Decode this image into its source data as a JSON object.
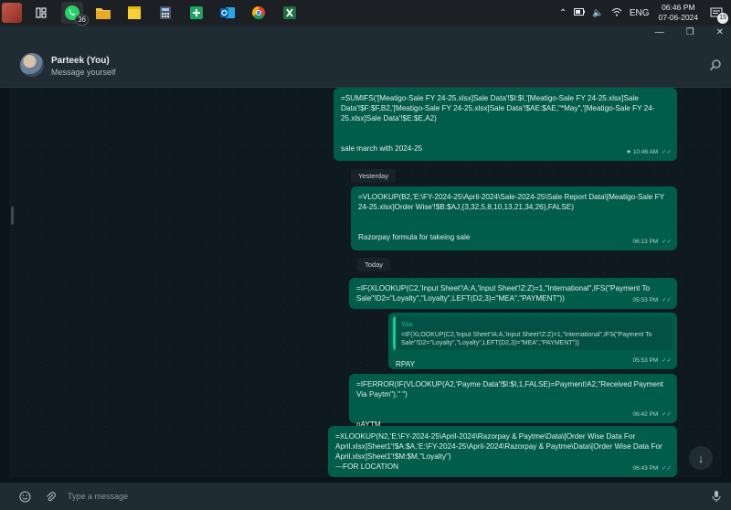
{
  "taskbar": {
    "apps": [
      {
        "name": "whatsapp",
        "badge": "36"
      },
      {
        "name": "file-explorer"
      },
      {
        "name": "sticky-notes"
      },
      {
        "name": "calculator"
      },
      {
        "name": "google-sheets"
      },
      {
        "name": "outlook"
      },
      {
        "name": "chrome"
      },
      {
        "name": "excel"
      }
    ],
    "language": "ENG",
    "time": "06:46 PM",
    "date": "07-06-2024",
    "notification_count": "15"
  },
  "header": {
    "name": "Parteek (You)",
    "subtitle": "Message yourself"
  },
  "messages": [
    {
      "text": "=SUMIFS('[Meatigo-Sale FY 24-25.xlsx]Sale Data'!$I:$I,'[Meatigo-Sale FY 24-25.xlsx]Sale Data'!$F:$F,B2,'[Meatigo-Sale FY 24-25.xlsx]Sale Data'!$AE:$AE,\"*May\",'[Meatigo-Sale FY 24-25.xlsx]Sale Data'!$E:$E,A2)\n\n\nsale march with 2024-25",
      "time": "10:46 AM",
      "starred": true
    },
    {
      "date_chip": "Yesterday"
    },
    {
      "text": "=VLOOKUP(B2,'E:\\FY-2024-25\\April-2024\\Sale-2024-25\\Sale Report Data\\[Meatigo-Sale FY 24-25.xlsx]Order Wise'!$B:$AJ,{3,32,5,8,10,13,21,34,26},FALSE)\n\n\nRazorpay formula for takeing sale",
      "time": "06:13 PM"
    },
    {
      "date_chip": "Today"
    },
    {
      "text": "=IF(XLOOKUP(C2,'Input Sheet'!A:A,'Input Sheet'!Z:Z)=1,\"International\",IFS(\"Payment To Sale\"!D2=\"Loyalty\",\"Loyalty\",LEFT(D2,3)=\"MEA\",\"PAYMENT\"))",
      "time": "05:53 PM"
    },
    {
      "quote_name": "You",
      "quote_text": "=IF(XLOOKUP(C2,'Input Sheet'!A:A,'Input Sheet'!Z:Z)=1,\"International\",IFS(\"Payment To Sale\"!D2=\"Loyalty\",\"Loyalty\",LEFT(D2,3)=\"MEA\",\"PAYMENT\"))",
      "text": "RPAY",
      "time": "05:53 PM"
    },
    {
      "text": "=IFERROR(IF(VLOOKUP(A2,'Payme Data'!$I:$I,1,FALSE)=Payment!A2,\"Received Payment Via Paytm\"),\" \")\n\n\npAYTM",
      "time": "06:42 PM"
    },
    {
      "text": "=XLOOKUP(N2,'E:\\FY-2024-25\\April-2024\\Razorpay & Paytme\\Data\\[Order Wise Data For April.xlsx]Sheet1'!$A:$A,'E:\\FY-2024-25\\April-2024\\Razorpay & Paytme\\Data\\[Order Wise Data For April.xlsx]Sheet1'!$M:$M,\"Loyalty\")\n---FOR LOCATION",
      "time": "06:43 PM"
    }
  ],
  "composer": {
    "placeholder": "Type a message"
  },
  "colors": {
    "bubble_outgoing": "#005c4b",
    "header": "#202c33",
    "chat_background": "#0b141a",
    "accent": "#06cf9c"
  }
}
